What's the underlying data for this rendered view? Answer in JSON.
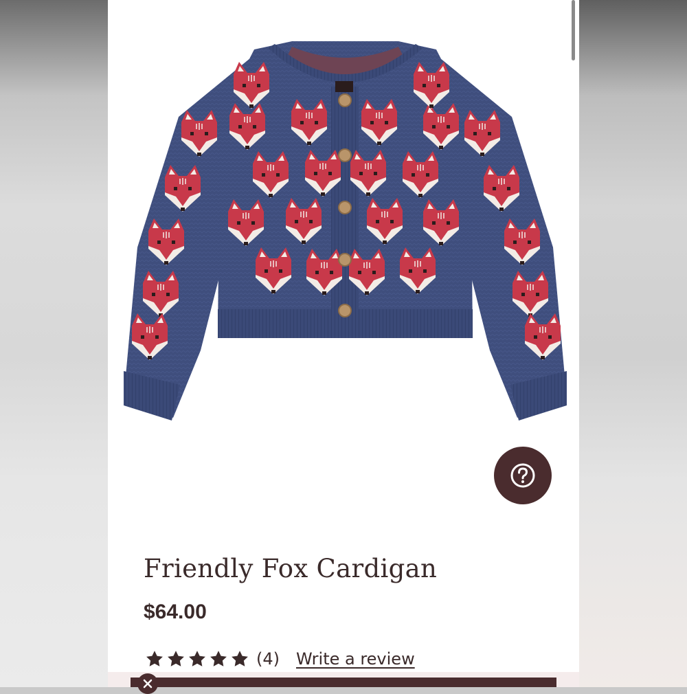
{
  "product": {
    "title": "Friendly Fox Cardigan",
    "price": "$64.00",
    "rating": 5,
    "rating_max": 5,
    "review_count": "(4)",
    "write_review_label": "Write a review"
  },
  "icons": {
    "help": "help-question-icon",
    "star": "star-icon",
    "close": "close-icon"
  },
  "colors": {
    "brand": "#4a2c2e",
    "text": "#3a2a2a",
    "cardigan_navy": "#3f4e7d",
    "fox_red": "#c8394a"
  }
}
